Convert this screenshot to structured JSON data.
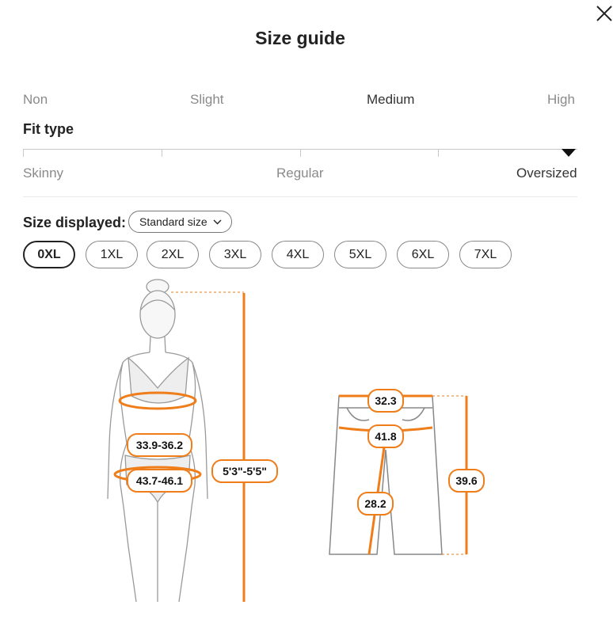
{
  "dialog": {
    "title": "Size guide",
    "close_icon": "close-icon"
  },
  "stretch": {
    "labels": [
      "Non",
      "Slight",
      "Medium",
      "High"
    ],
    "selected": "Medium"
  },
  "fit": {
    "title": "Fit type",
    "labels": [
      "Skinny",
      "Regular",
      "Oversized"
    ],
    "selected": "Oversized"
  },
  "size_display": {
    "label": "Size displayed:",
    "dropdown_value": "Standard size"
  },
  "sizes": {
    "options": [
      "0XL",
      "1XL",
      "2XL",
      "3XL",
      "4XL",
      "5XL",
      "6XL",
      "7XL"
    ],
    "selected": "0XL"
  },
  "body_measurements": {
    "waist": "33.9-36.2",
    "hip": "43.7-46.1",
    "height": "5'3\"-5'5\""
  },
  "garment_measurements": {
    "waist": "32.3",
    "hip": "41.8",
    "inseam": "28.2",
    "length": "39.6"
  },
  "colors": {
    "accent": "#ef7d1a",
    "text": "#222222",
    "muted": "#8a8a8a"
  }
}
